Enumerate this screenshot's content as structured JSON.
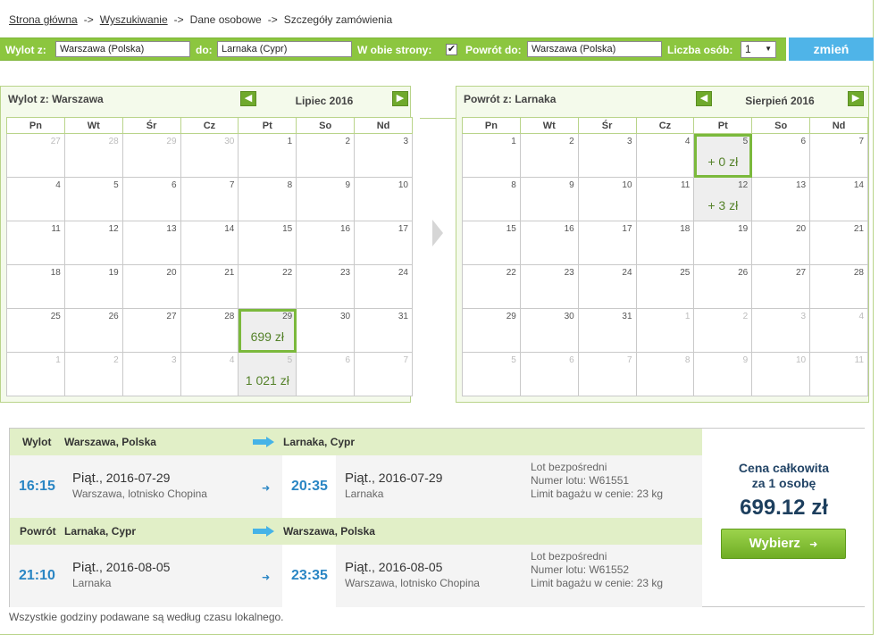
{
  "breadcrumb": {
    "items": [
      "Strona główna",
      "Wyszukiwanie",
      "Dane osobowe",
      "Szczegóły zamówienia"
    ],
    "separator": "->"
  },
  "search": {
    "from_label": "Wylot z:",
    "from_value": "Warszawa (Polska)",
    "to_label": "do:",
    "to_value": "Larnaka (Cypr)",
    "roundtrip_label": "W obie strony:",
    "roundtrip_checked": "✔",
    "return_label": "Powrót do:",
    "return_value": "Warszawa (Polska)",
    "persons_label": "Liczba osób:",
    "persons_value": "1",
    "change_button": "zmień"
  },
  "outbound_calendar": {
    "header_label": "Wylot z:",
    "header_city": "Warszawa",
    "month": "Lipiec 2016",
    "weekdays": [
      "Pn",
      "Wt",
      "Śr",
      "Cz",
      "Pt",
      "So",
      "Nd"
    ],
    "days": [
      [
        "27",
        "28",
        "29",
        "30",
        "1",
        "2",
        "3"
      ],
      [
        "4",
        "5",
        "6",
        "7",
        "8",
        "9",
        "10"
      ],
      [
        "11",
        "12",
        "13",
        "14",
        "15",
        "16",
        "17"
      ],
      [
        "18",
        "19",
        "20",
        "21",
        "22",
        "23",
        "24"
      ],
      [
        "25",
        "26",
        "27",
        "28",
        "29",
        "30",
        "31"
      ],
      [
        "1",
        "2",
        "3",
        "4",
        "5",
        "6",
        "7"
      ]
    ],
    "prices": {
      "29": "699 zł",
      "5": "1 021 zł"
    }
  },
  "return_calendar": {
    "header_label": "Powrót z:",
    "header_city": "Larnaka",
    "month": "Sierpień 2016",
    "weekdays": [
      "Pn",
      "Wt",
      "Śr",
      "Cz",
      "Pt",
      "So",
      "Nd"
    ],
    "days": [
      [
        "1",
        "2",
        "3",
        "4",
        "5",
        "6",
        "7"
      ],
      [
        "8",
        "9",
        "10",
        "11",
        "12",
        "13",
        "14"
      ],
      [
        "15",
        "16",
        "17",
        "18",
        "19",
        "20",
        "21"
      ],
      [
        "22",
        "23",
        "24",
        "25",
        "26",
        "27",
        "28"
      ],
      [
        "29",
        "30",
        "31",
        "1",
        "2",
        "3",
        "4"
      ],
      [
        "5",
        "6",
        "7",
        "8",
        "9",
        "10",
        "11"
      ]
    ],
    "prices": {
      "5": "+ 0 zł",
      "12": "+ 3 zł"
    }
  },
  "outbound": {
    "label": "Wylot",
    "from": "Warszawa, Polska",
    "to": "Larnaka, Cypr",
    "dep_time": "16:15",
    "dep_day": "Piąt.",
    "dep_date": ", 2016-07-29",
    "dep_place": "Warszawa, lotnisko Chopina",
    "arr_time": "20:35",
    "arr_day": "Piąt.",
    "arr_date": ", 2016-07-29",
    "arr_place": "Larnaka",
    "info1": "Lot bezpośredni",
    "info2": "Numer lotu: W61551",
    "info3": "Limit bagażu w cenie: 23 kg"
  },
  "return": {
    "label": "Powrót",
    "from": "Larnaka, Cypr",
    "to": "Warszawa, Polska",
    "dep_time": "21:10",
    "dep_day": "Piąt.",
    "dep_date": ", 2016-08-05",
    "dep_place": "Larnaka",
    "arr_time": "23:35",
    "arr_day": "Piąt.",
    "arr_date": ", 2016-08-05",
    "arr_place": "Warszawa, lotnisko Chopina",
    "info1": "Lot bezpośredni",
    "info2": "Numer lotu: W61552",
    "info3": "Limit bagażu w cenie: 23 kg"
  },
  "price": {
    "line1": "Cena całkowita",
    "line2": "za 1 osobę",
    "amount": "699.12 zł",
    "select_button": "Wybierz"
  },
  "footer_note": "Wszystkie godziny podawane są według czasu lokalnego.",
  "colors": {
    "accent_green": "#8cc63f",
    "accent_blue": "#4fb4e8",
    "time_blue": "#2a86c4"
  }
}
